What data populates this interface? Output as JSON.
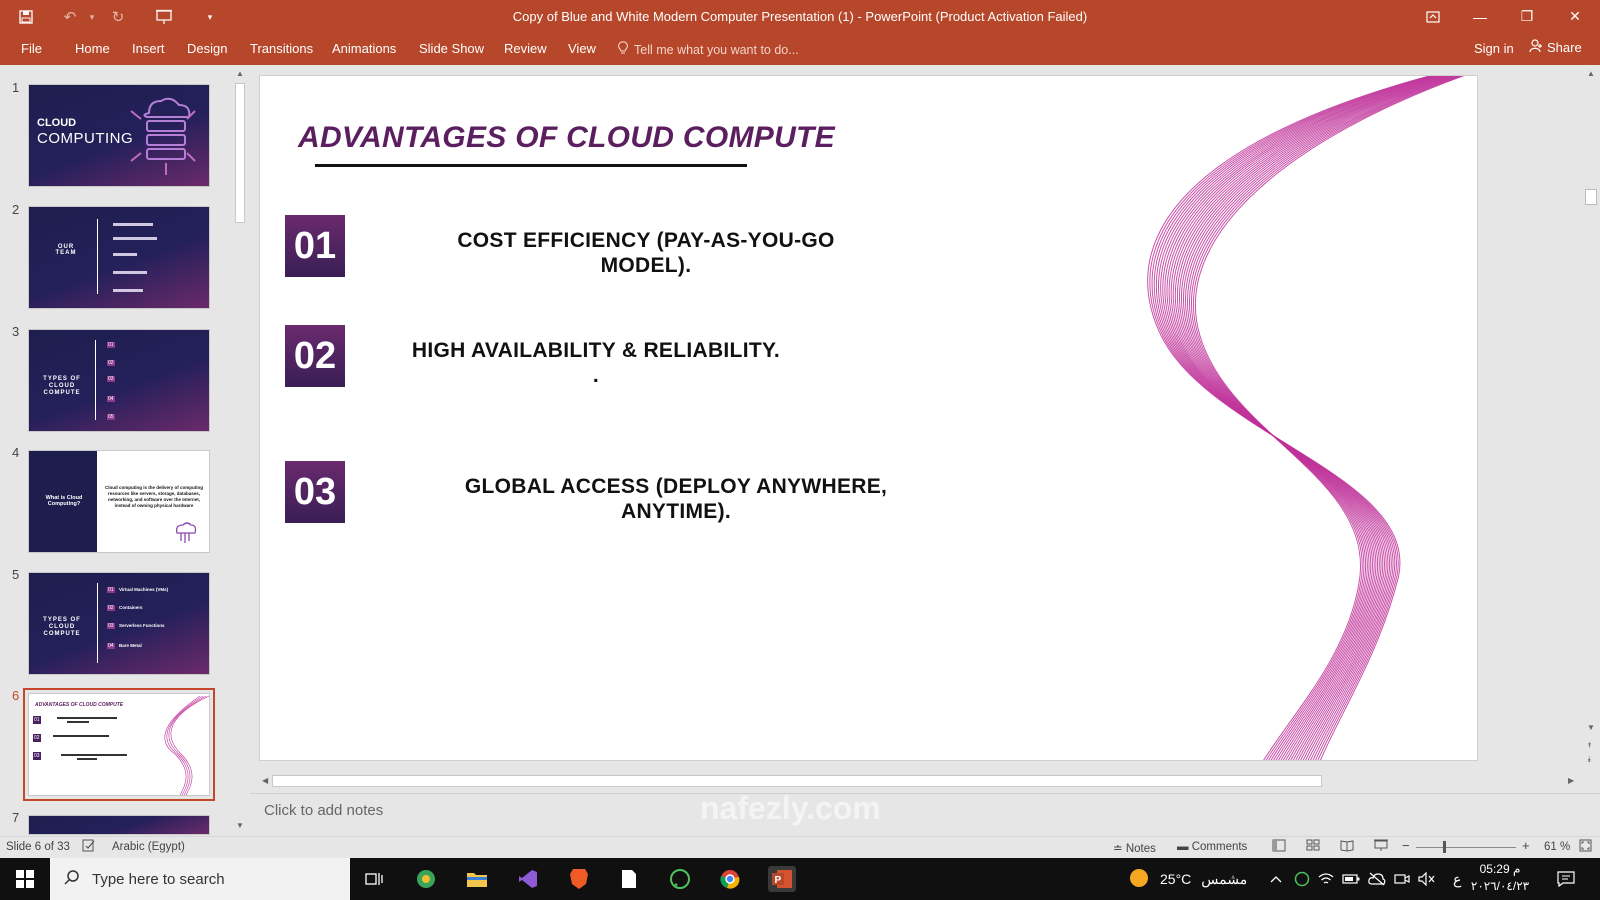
{
  "window": {
    "title": "Copy of Blue and White Modern Computer Presentation (1) - PowerPoint (Product Activation Failed)"
  },
  "ribbon": {
    "tabs": [
      "File",
      "Home",
      "Insert",
      "Design",
      "Transitions",
      "Animations",
      "Slide Show",
      "Review",
      "View"
    ],
    "tell_me": "Tell me what you want to do...",
    "sign_in": "Sign in",
    "share": "Share"
  },
  "thumbnails": {
    "numbers": [
      "1",
      "2",
      "3",
      "4",
      "5",
      "6",
      "7"
    ],
    "selected": 6,
    "slide1": {
      "line1": "CLOUD",
      "line2": "COMPUTING"
    },
    "slide2": {
      "heading": "OUR TEAM"
    },
    "slide3": {
      "heading": "TYPES OF CLOUD COMPUTE",
      "items": [
        "01",
        "02",
        "03",
        "04",
        "05"
      ]
    },
    "slide4": {
      "heading": "What is Cloud Computing?",
      "body": "Cloud computing is the delivery of computing resources like servers, storage, databases, networking, and software over the Internet, instead of owning physical hardware"
    },
    "slide5": {
      "heading": "TYPES OF CLOUD COMPUTE",
      "items": [
        "Virtual Machines (VMs)",
        "Containers",
        "Serverless Functions",
        "Bare Metal"
      ],
      "nums": [
        "01",
        "02",
        "03",
        "04"
      ]
    },
    "slide6": {
      "heading": "ADVANTAGES OF CLOUD COMPUTE",
      "nums": [
        "01",
        "02",
        "03"
      ]
    }
  },
  "slide": {
    "title": "ADVANTAGES OF CLOUD COMPUTE",
    "items": [
      {
        "num": "01",
        "line1": "COST EFFICIENCY (PAY-AS-YOU-GO",
        "line2": "MODEL)."
      },
      {
        "num": "02",
        "line1": "HIGH AVAILABILITY & RELIABILITY.",
        "line2": "."
      },
      {
        "num": "03",
        "line1": "GLOBAL ACCESS (DEPLOY ANYWHERE,",
        "line2": "ANYTIME)."
      }
    ],
    "colors": {
      "title": "#5b1f5f",
      "box_top": "#6a2a6e",
      "box_bottom": "#3a1e55",
      "wave": "#c0329a"
    }
  },
  "notes": {
    "placeholder": "Click to add notes"
  },
  "status": {
    "slide_count": "Slide 6 of 33",
    "language": "Arabic (Egypt)",
    "notes": "Notes",
    "comments": "Comments",
    "zoom": "61 %"
  },
  "taskbar": {
    "search_placeholder": "Type here to search",
    "temperature": "25°C",
    "weather": "مشمس",
    "time": "05:29 م",
    "date": "٢٠٢٦/٠٤/٢٣",
    "lang": "ع",
    "watermark": "nafezly.com"
  }
}
